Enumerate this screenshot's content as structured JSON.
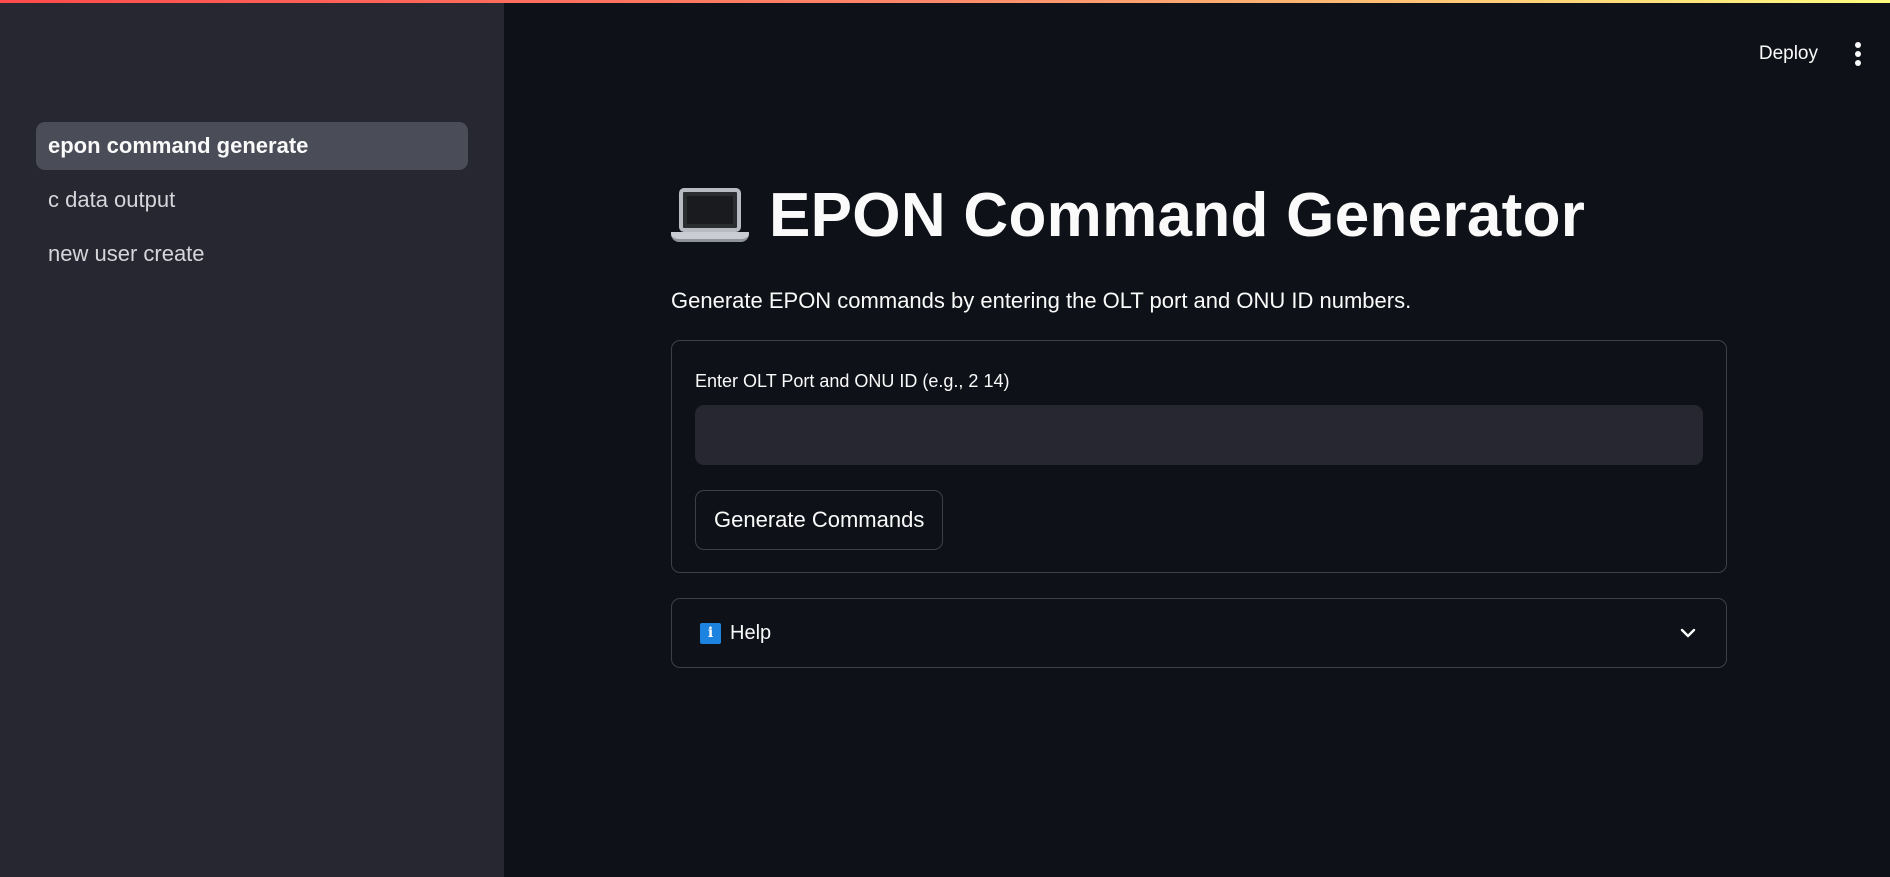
{
  "sidebar": {
    "items": [
      {
        "label": "epon command generate",
        "active": true
      },
      {
        "label": "c data output",
        "active": false
      },
      {
        "label": "new user create",
        "active": false
      }
    ]
  },
  "header": {
    "deploy_label": "Deploy",
    "menu_icon": "vertical-ellipsis-icon"
  },
  "main": {
    "title_icon": "laptop-emoji",
    "title": "EPON Command Generator",
    "description": "Generate EPON commands by entering the OLT port and ONU ID numbers.",
    "form": {
      "input_label": "Enter OLT Port and ONU ID (e.g., 2 14)",
      "input_value": "",
      "button_label": "Generate Commands"
    },
    "help": {
      "icon": "info-icon",
      "label": "Help",
      "expanded": false
    }
  },
  "colors": {
    "background": "#0e1117",
    "sidebar": "#262730",
    "active_item": "#4a4c57",
    "info_blue": "#1c83e1"
  }
}
